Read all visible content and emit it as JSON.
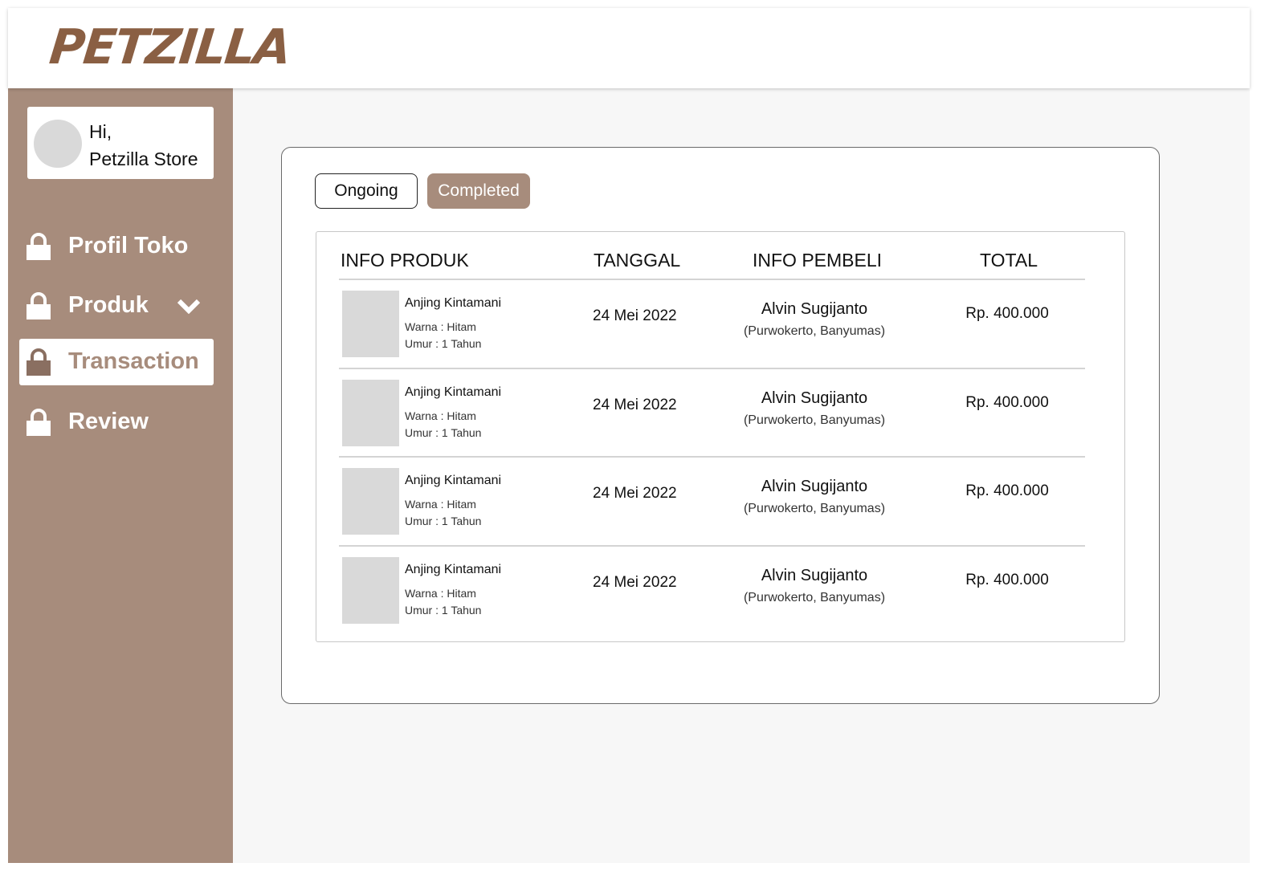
{
  "app": {
    "logo": "PETZILLA"
  },
  "greeting": {
    "hi": "Hi,",
    "name": "Petzilla Store"
  },
  "nav": [
    {
      "label": "Profil Toko",
      "icon": "lock-icon"
    },
    {
      "label": "Produk",
      "icon": "lock-icon",
      "has_dropdown": true
    },
    {
      "label": "Transaction",
      "icon": "lock-icon",
      "active": true
    },
    {
      "label": "Review",
      "icon": "lock-icon"
    }
  ],
  "tabs": [
    {
      "label": "Ongoing"
    },
    {
      "label": "Completed",
      "active": true
    }
  ],
  "table": {
    "headers": [
      "INFO PRODUK",
      "TANGGAL",
      "INFO PEMBELI",
      "TOTAL"
    ],
    "rows": [
      {
        "product": "Anjing Kintamani",
        "color": "Warna : Hitam",
        "age": "Umur : 1 Tahun",
        "date": "24 Mei 2022",
        "buyer": "Alvin Sugijanto",
        "location": "(Purwokerto, Banyumas)",
        "total": "Rp. 400.000"
      },
      {
        "product": "Anjing Kintamani",
        "color": "Warna : Hitam",
        "age": "Umur : 1 Tahun",
        "date": "24 Mei 2022",
        "buyer": "Alvin Sugijanto",
        "location": "(Purwokerto, Banyumas)",
        "total": "Rp. 400.000"
      },
      {
        "product": "Anjing Kintamani",
        "color": "Warna : Hitam",
        "age": "Umur : 1 Tahun",
        "date": "24 Mei 2022",
        "buyer": "Alvin Sugijanto",
        "location": "(Purwokerto, Banyumas)",
        "total": "Rp. 400.000"
      },
      {
        "product": "Anjing Kintamani",
        "color": "Warna : Hitam",
        "age": "Umur : 1 Tahun",
        "date": "24 Mei 2022",
        "buyer": "Alvin Sugijanto",
        "location": "(Purwokerto, Banyumas)",
        "total": "Rp. 400.000"
      }
    ]
  },
  "colors": {
    "brand": "#8a5f43",
    "sidebar": "#a78c7c",
    "active_tab": "#a78c7c",
    "content_bg": "#f7f7f7"
  }
}
